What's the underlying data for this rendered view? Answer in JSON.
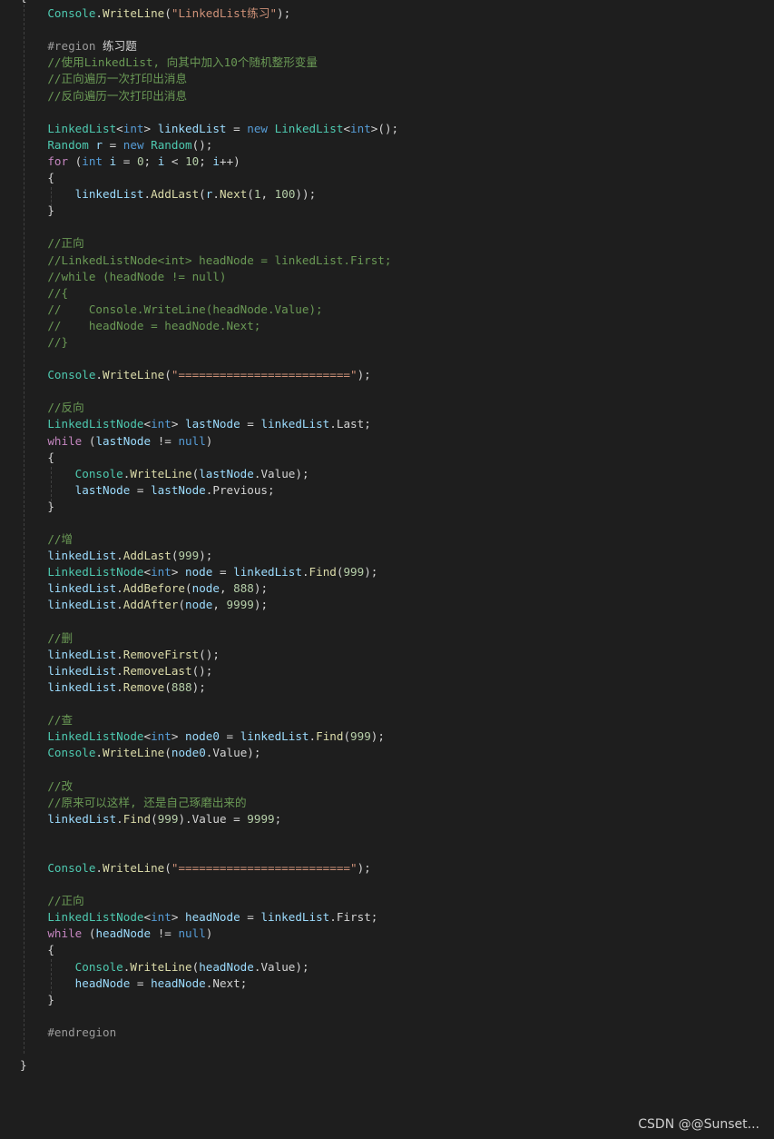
{
  "editor": {
    "theme_colors": {
      "background": "#1e1e1e",
      "plain": "#d4d4d4",
      "type": "#4ec9b0",
      "method": "#dcdcaa",
      "string": "#ce9178",
      "keyword": "#569cd6",
      "control": "#c586c0",
      "variable": "#9cdcfe",
      "number": "#b5cea8",
      "comment": "#6a9955",
      "region": "#9b9b9b"
    },
    "lines": [
      [
        [
          "plain",
          "{"
        ]
      ],
      [
        [
          "plain",
          "    "
        ],
        [
          "type",
          "Console"
        ],
        [
          "plain",
          "."
        ],
        [
          "method",
          "WriteLine"
        ],
        [
          "plain",
          "("
        ],
        [
          "string",
          "\"LinkedList练习\""
        ],
        [
          "plain",
          ");"
        ]
      ],
      [],
      [
        [
          "plain",
          "    "
        ],
        [
          "region",
          "#region"
        ],
        [
          "plain",
          " 练习题"
        ]
      ],
      [
        [
          "plain",
          "    "
        ],
        [
          "comment",
          "//使用LinkedList, 向其中加入10个随机整形变量"
        ]
      ],
      [
        [
          "plain",
          "    "
        ],
        [
          "comment",
          "//正向遍历一次打印出消息"
        ]
      ],
      [
        [
          "plain",
          "    "
        ],
        [
          "comment",
          "//反向遍历一次打印出消息"
        ]
      ],
      [],
      [
        [
          "plain",
          "    "
        ],
        [
          "type",
          "LinkedList"
        ],
        [
          "plain",
          "<"
        ],
        [
          "keyword",
          "int"
        ],
        [
          "plain",
          "> "
        ],
        [
          "var",
          "linkedList"
        ],
        [
          "plain",
          " = "
        ],
        [
          "keyword",
          "new"
        ],
        [
          "plain",
          " "
        ],
        [
          "type",
          "LinkedList"
        ],
        [
          "plain",
          "<"
        ],
        [
          "keyword",
          "int"
        ],
        [
          "plain",
          ">();"
        ]
      ],
      [
        [
          "plain",
          "    "
        ],
        [
          "type",
          "Random"
        ],
        [
          "plain",
          " "
        ],
        [
          "var",
          "r"
        ],
        [
          "plain",
          " = "
        ],
        [
          "keyword",
          "new"
        ],
        [
          "plain",
          " "
        ],
        [
          "type",
          "Random"
        ],
        [
          "plain",
          "();"
        ]
      ],
      [
        [
          "plain",
          "    "
        ],
        [
          "control",
          "for"
        ],
        [
          "plain",
          " ("
        ],
        [
          "keyword",
          "int"
        ],
        [
          "plain",
          " "
        ],
        [
          "var",
          "i"
        ],
        [
          "plain",
          " = "
        ],
        [
          "number",
          "0"
        ],
        [
          "plain",
          "; "
        ],
        [
          "var",
          "i"
        ],
        [
          "plain",
          " < "
        ],
        [
          "number",
          "10"
        ],
        [
          "plain",
          "; "
        ],
        [
          "var",
          "i"
        ],
        [
          "plain",
          "++)"
        ]
      ],
      [
        [
          "plain",
          "    {"
        ]
      ],
      [
        [
          "plain",
          "        "
        ],
        [
          "var",
          "linkedList"
        ],
        [
          "plain",
          "."
        ],
        [
          "method",
          "AddLast"
        ],
        [
          "plain",
          "("
        ],
        [
          "var",
          "r"
        ],
        [
          "plain",
          "."
        ],
        [
          "method",
          "Next"
        ],
        [
          "plain",
          "("
        ],
        [
          "number",
          "1"
        ],
        [
          "plain",
          ", "
        ],
        [
          "number",
          "100"
        ],
        [
          "plain",
          "));"
        ]
      ],
      [
        [
          "plain",
          "    }"
        ]
      ],
      [],
      [
        [
          "plain",
          "    "
        ],
        [
          "comment",
          "//正向"
        ]
      ],
      [
        [
          "plain",
          "    "
        ],
        [
          "comment",
          "//LinkedListNode<int> headNode = linkedList.First;"
        ]
      ],
      [
        [
          "plain",
          "    "
        ],
        [
          "comment",
          "//while (headNode != null)"
        ]
      ],
      [
        [
          "plain",
          "    "
        ],
        [
          "comment",
          "//{"
        ]
      ],
      [
        [
          "plain",
          "    "
        ],
        [
          "comment",
          "//    Console.WriteLine(headNode.Value);"
        ]
      ],
      [
        [
          "plain",
          "    "
        ],
        [
          "comment",
          "//    headNode = headNode.Next;"
        ]
      ],
      [
        [
          "plain",
          "    "
        ],
        [
          "comment",
          "//}"
        ]
      ],
      [],
      [
        [
          "plain",
          "    "
        ],
        [
          "type",
          "Console"
        ],
        [
          "plain",
          "."
        ],
        [
          "method",
          "WriteLine"
        ],
        [
          "plain",
          "("
        ],
        [
          "string",
          "\"=========================\""
        ],
        [
          "plain",
          ");"
        ]
      ],
      [],
      [
        [
          "plain",
          "    "
        ],
        [
          "comment",
          "//反向"
        ]
      ],
      [
        [
          "plain",
          "    "
        ],
        [
          "type",
          "LinkedListNode"
        ],
        [
          "plain",
          "<"
        ],
        [
          "keyword",
          "int"
        ],
        [
          "plain",
          "> "
        ],
        [
          "var",
          "lastNode"
        ],
        [
          "plain",
          " = "
        ],
        [
          "var",
          "linkedList"
        ],
        [
          "plain",
          "."
        ],
        [
          "prop",
          "Last"
        ],
        [
          "plain",
          ";"
        ]
      ],
      [
        [
          "plain",
          "    "
        ],
        [
          "control",
          "while"
        ],
        [
          "plain",
          " ("
        ],
        [
          "var",
          "lastNode"
        ],
        [
          "plain",
          " != "
        ],
        [
          "keyword",
          "null"
        ],
        [
          "plain",
          ")"
        ]
      ],
      [
        [
          "plain",
          "    {"
        ]
      ],
      [
        [
          "plain",
          "        "
        ],
        [
          "type",
          "Console"
        ],
        [
          "plain",
          "."
        ],
        [
          "method",
          "WriteLine"
        ],
        [
          "plain",
          "("
        ],
        [
          "var",
          "lastNode"
        ],
        [
          "plain",
          "."
        ],
        [
          "prop",
          "Value"
        ],
        [
          "plain",
          ");"
        ]
      ],
      [
        [
          "plain",
          "        "
        ],
        [
          "var",
          "lastNode"
        ],
        [
          "plain",
          " = "
        ],
        [
          "var",
          "lastNode"
        ],
        [
          "plain",
          "."
        ],
        [
          "prop",
          "Previous"
        ],
        [
          "plain",
          ";"
        ]
      ],
      [
        [
          "plain",
          "    }"
        ]
      ],
      [],
      [
        [
          "plain",
          "    "
        ],
        [
          "comment",
          "//增"
        ]
      ],
      [
        [
          "plain",
          "    "
        ],
        [
          "var",
          "linkedList"
        ],
        [
          "plain",
          "."
        ],
        [
          "method",
          "AddLast"
        ],
        [
          "plain",
          "("
        ],
        [
          "number",
          "999"
        ],
        [
          "plain",
          ");"
        ]
      ],
      [
        [
          "plain",
          "    "
        ],
        [
          "type",
          "LinkedListNode"
        ],
        [
          "plain",
          "<"
        ],
        [
          "keyword",
          "int"
        ],
        [
          "plain",
          "> "
        ],
        [
          "var",
          "node"
        ],
        [
          "plain",
          " = "
        ],
        [
          "var",
          "linkedList"
        ],
        [
          "plain",
          "."
        ],
        [
          "method",
          "Find"
        ],
        [
          "plain",
          "("
        ],
        [
          "number",
          "999"
        ],
        [
          "plain",
          ");"
        ]
      ],
      [
        [
          "plain",
          "    "
        ],
        [
          "var",
          "linkedList"
        ],
        [
          "plain",
          "."
        ],
        [
          "method",
          "AddBefore"
        ],
        [
          "plain",
          "("
        ],
        [
          "var",
          "node"
        ],
        [
          "plain",
          ", "
        ],
        [
          "number",
          "888"
        ],
        [
          "plain",
          ");"
        ]
      ],
      [
        [
          "plain",
          "    "
        ],
        [
          "var",
          "linkedList"
        ],
        [
          "plain",
          "."
        ],
        [
          "method",
          "AddAfter"
        ],
        [
          "plain",
          "("
        ],
        [
          "var",
          "node"
        ],
        [
          "plain",
          ", "
        ],
        [
          "number",
          "9999"
        ],
        [
          "plain",
          ");"
        ]
      ],
      [],
      [
        [
          "plain",
          "    "
        ],
        [
          "comment",
          "//删"
        ]
      ],
      [
        [
          "plain",
          "    "
        ],
        [
          "var",
          "linkedList"
        ],
        [
          "plain",
          "."
        ],
        [
          "method",
          "RemoveFirst"
        ],
        [
          "plain",
          "();"
        ]
      ],
      [
        [
          "plain",
          "    "
        ],
        [
          "var",
          "linkedList"
        ],
        [
          "plain",
          "."
        ],
        [
          "method",
          "RemoveLast"
        ],
        [
          "plain",
          "();"
        ]
      ],
      [
        [
          "plain",
          "    "
        ],
        [
          "var",
          "linkedList"
        ],
        [
          "plain",
          "."
        ],
        [
          "method",
          "Remove"
        ],
        [
          "plain",
          "("
        ],
        [
          "number",
          "888"
        ],
        [
          "plain",
          ");"
        ]
      ],
      [],
      [
        [
          "plain",
          "    "
        ],
        [
          "comment",
          "//查"
        ]
      ],
      [
        [
          "plain",
          "    "
        ],
        [
          "type",
          "LinkedListNode"
        ],
        [
          "plain",
          "<"
        ],
        [
          "keyword",
          "int"
        ],
        [
          "plain",
          "> "
        ],
        [
          "var",
          "node0"
        ],
        [
          "plain",
          " = "
        ],
        [
          "var",
          "linkedList"
        ],
        [
          "plain",
          "."
        ],
        [
          "method",
          "Find"
        ],
        [
          "plain",
          "("
        ],
        [
          "number",
          "999"
        ],
        [
          "plain",
          ");"
        ]
      ],
      [
        [
          "plain",
          "    "
        ],
        [
          "type",
          "Console"
        ],
        [
          "plain",
          "."
        ],
        [
          "method",
          "WriteLine"
        ],
        [
          "plain",
          "("
        ],
        [
          "var",
          "node0"
        ],
        [
          "plain",
          "."
        ],
        [
          "prop",
          "Value"
        ],
        [
          "plain",
          ");"
        ]
      ],
      [],
      [
        [
          "plain",
          "    "
        ],
        [
          "comment",
          "//改"
        ]
      ],
      [
        [
          "plain",
          "    "
        ],
        [
          "comment",
          "//原来可以这样, 还是自己琢磨出来的"
        ]
      ],
      [
        [
          "plain",
          "    "
        ],
        [
          "var",
          "linkedList"
        ],
        [
          "plain",
          "."
        ],
        [
          "method",
          "Find"
        ],
        [
          "plain",
          "("
        ],
        [
          "number",
          "999"
        ],
        [
          "plain",
          ")."
        ],
        [
          "prop",
          "Value"
        ],
        [
          "plain",
          " = "
        ],
        [
          "number",
          "9999"
        ],
        [
          "plain",
          ";"
        ]
      ],
      [],
      [],
      [
        [
          "plain",
          "    "
        ],
        [
          "type",
          "Console"
        ],
        [
          "plain",
          "."
        ],
        [
          "method",
          "WriteLine"
        ],
        [
          "plain",
          "("
        ],
        [
          "string",
          "\"=========================\""
        ],
        [
          "plain",
          ");"
        ]
      ],
      [],
      [
        [
          "plain",
          "    "
        ],
        [
          "comment",
          "//正向"
        ]
      ],
      [
        [
          "plain",
          "    "
        ],
        [
          "type",
          "LinkedListNode"
        ],
        [
          "plain",
          "<"
        ],
        [
          "keyword",
          "int"
        ],
        [
          "plain",
          "> "
        ],
        [
          "var",
          "headNode"
        ],
        [
          "plain",
          " = "
        ],
        [
          "var",
          "linkedList"
        ],
        [
          "plain",
          "."
        ],
        [
          "prop",
          "First"
        ],
        [
          "plain",
          ";"
        ]
      ],
      [
        [
          "plain",
          "    "
        ],
        [
          "control",
          "while"
        ],
        [
          "plain",
          " ("
        ],
        [
          "var",
          "headNode"
        ],
        [
          "plain",
          " != "
        ],
        [
          "keyword",
          "null"
        ],
        [
          "plain",
          ")"
        ]
      ],
      [
        [
          "plain",
          "    {"
        ]
      ],
      [
        [
          "plain",
          "        "
        ],
        [
          "type",
          "Console"
        ],
        [
          "plain",
          "."
        ],
        [
          "method",
          "WriteLine"
        ],
        [
          "plain",
          "("
        ],
        [
          "var",
          "headNode"
        ],
        [
          "plain",
          "."
        ],
        [
          "prop",
          "Value"
        ],
        [
          "plain",
          ");"
        ]
      ],
      [
        [
          "plain",
          "        "
        ],
        [
          "var",
          "headNode"
        ],
        [
          "plain",
          " = "
        ],
        [
          "var",
          "headNode"
        ],
        [
          "plain",
          "."
        ],
        [
          "prop",
          "Next"
        ],
        [
          "plain",
          ";"
        ]
      ],
      [
        [
          "plain",
          "    }"
        ]
      ],
      [],
      [
        [
          "plain",
          "    "
        ],
        [
          "region",
          "#endregion"
        ]
      ],
      [],
      [
        [
          "plain",
          "}"
        ]
      ]
    ]
  },
  "watermark": {
    "text": "CSDN @@Sunset..."
  }
}
